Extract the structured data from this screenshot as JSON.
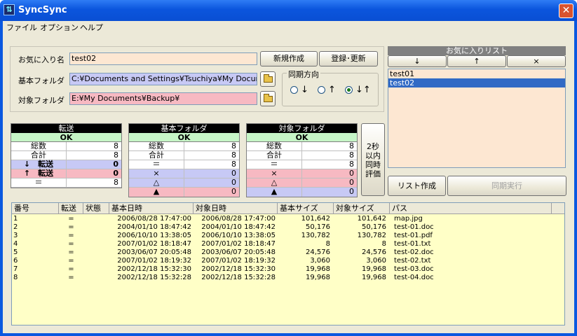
{
  "window": {
    "title": "SyncSync"
  },
  "menu": [
    {
      "label": "ファイル"
    },
    {
      "label": "オプション"
    },
    {
      "label": "ヘルプ"
    }
  ],
  "form": {
    "favorite_label": "お気に入り名",
    "favorite_value": "test02",
    "base_label": "基本フォルダ",
    "base_value": "C:¥Documents and Settings¥Tsuchiya¥My Documen",
    "target_label": "対象フォルダ",
    "target_value": "E:¥My Documents¥Backup¥",
    "new_button": "新規作成",
    "register_button": "登録･更新"
  },
  "sync": {
    "title": "同期方向",
    "options": [
      {
        "label": "↓",
        "selected": false
      },
      {
        "label": "↑",
        "selected": false
      },
      {
        "label": "↓↑",
        "selected": true
      }
    ]
  },
  "favorites": {
    "title": "お気に入りリスト",
    "buttons": [
      "↓",
      "↑",
      "×"
    ],
    "items": [
      {
        "label": "test01",
        "selected": false
      },
      {
        "label": "test02",
        "selected": true
      }
    ]
  },
  "transfer": {
    "title": "転送",
    "status": "OK",
    "rows": [
      {
        "k": "総数",
        "v": "8"
      },
      {
        "k": "合計",
        "v": "8"
      },
      {
        "k": "↓　転送",
        "v": "0"
      },
      {
        "k": "↑　転送",
        "v": "0"
      },
      {
        "k": "＝",
        "v": "8"
      }
    ]
  },
  "basefolder": {
    "title": "基本フォルダ",
    "status": "OK",
    "rows": [
      {
        "k": "総数",
        "v": "8"
      },
      {
        "k": "合計",
        "v": "8"
      },
      {
        "k": "＝",
        "v": "8"
      },
      {
        "k": "×",
        "v": "0"
      },
      {
        "k": "△",
        "v": "0"
      },
      {
        "k": "▲",
        "v": "0"
      }
    ]
  },
  "targetfolder": {
    "title": "対象フォルダ",
    "status": "OK",
    "rows": [
      {
        "k": "総数",
        "v": "8"
      },
      {
        "k": "合計",
        "v": "8"
      },
      {
        "k": "＝",
        "v": "8"
      },
      {
        "k": "×",
        "v": "0"
      },
      {
        "k": "△",
        "v": "0"
      },
      {
        "k": "▲",
        "v": "0"
      }
    ]
  },
  "sync_eval": {
    "lines": [
      "2秒",
      "以内",
      "同時",
      "評価"
    ]
  },
  "actions": {
    "list_button": "リスト作成",
    "execute_button": "同期実行"
  },
  "table": {
    "headers": [
      "番号",
      "転送",
      "状態",
      "基本日時",
      "対象日時",
      "基本サイズ",
      "対象サイズ",
      "パス"
    ],
    "rows": [
      [
        "1",
        "=",
        "",
        "2006/08/28 17:47:00",
        "2006/08/28 17:47:00",
        "101,642",
        "101,642",
        "map.jpg"
      ],
      [
        "2",
        "=",
        "",
        "2004/01/10 18:47:42",
        "2004/01/10 18:47:42",
        "50,176",
        "50,176",
        "test-01.doc"
      ],
      [
        "3",
        "=",
        "",
        "2006/10/10 13:38:05",
        "2006/10/10 13:38:05",
        "130,782",
        "130,782",
        "test-01.pdf"
      ],
      [
        "4",
        "=",
        "",
        "2007/01/02 18:18:47",
        "2007/01/02 18:18:47",
        "8",
        "8",
        "test-01.txt"
      ],
      [
        "5",
        "=",
        "",
        "2003/06/07 20:05:48",
        "2003/06/07 20:05:48",
        "24,576",
        "24,576",
        "test-02.doc"
      ],
      [
        "6",
        "=",
        "",
        "2007/01/02 18:19:32",
        "2007/01/02 18:19:32",
        "3,060",
        "3,060",
        "test-02.txt"
      ],
      [
        "7",
        "=",
        "",
        "2002/12/18 15:32:30",
        "2002/12/18 15:32:30",
        "19,968",
        "19,968",
        "test-03.doc"
      ],
      [
        "8",
        "=",
        "",
        "2002/12/18 15:32:28",
        "2002/12/18 15:32:28",
        "19,968",
        "19,968",
        "test-04.doc"
      ]
    ]
  },
  "colors": {
    "favorite_bg": "#fde7d2",
    "base_bg": "#c7c9f5",
    "target_bg": "#f7b9c2",
    "table_bg": "#ffffc7",
    "ok_bg": "#c6f5c6"
  }
}
